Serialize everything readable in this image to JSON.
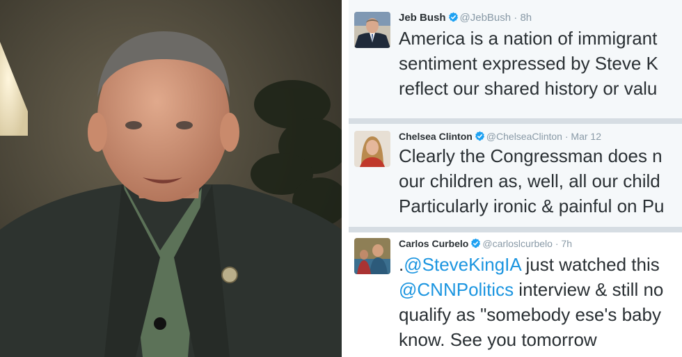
{
  "tweets": [
    {
      "name": "Jeb Bush",
      "handle": "@JebBush",
      "time": "8h",
      "lines": [
        "America is a nation of immigrant",
        "sentiment expressed by Steve K",
        "reflect our shared history or valu"
      ]
    },
    {
      "name": "Chelsea Clinton",
      "handle": "@ChelseaClinton",
      "time": "Mar 12",
      "lines": [
        "Clearly the Congressman does n",
        "our children as, well, all our child",
        "Particularly ironic & painful on Pu"
      ]
    },
    {
      "name": "Carlos Curbelo",
      "handle": "@carloslcurbelo",
      "time": "7h",
      "line1_prefix": ".",
      "line1_mention": "@SteveKingIA",
      "line1_rest": " just watched this",
      "line2_mention": "@CNNPolitics",
      "line2_rest": " interview & still no",
      "line3": "qualify as \"somebody ese's baby",
      "line4": "know. See you tomorrow"
    }
  ],
  "separator": " · ",
  "colors": {
    "verified": "#1da1f2",
    "mention": "#1b95e0",
    "name": "#292f33",
    "meta": "#8899a6"
  },
  "icons": [
    "verified-badge-icon"
  ]
}
